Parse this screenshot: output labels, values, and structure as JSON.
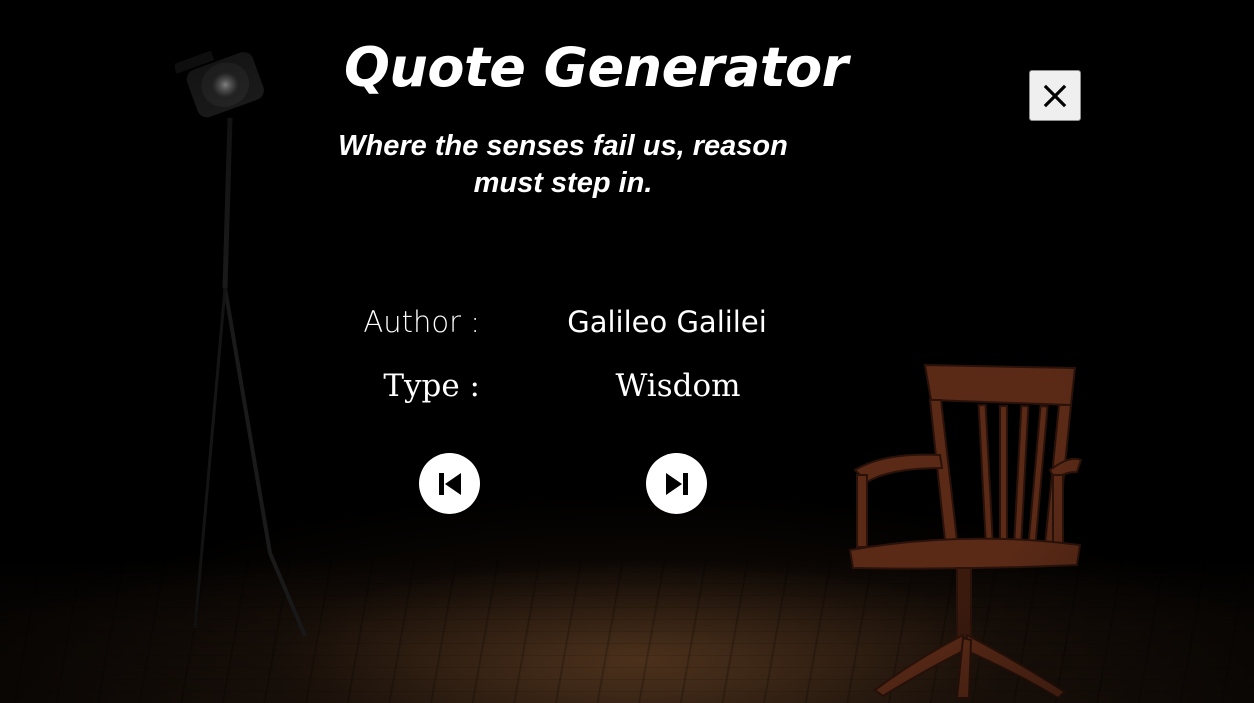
{
  "app": {
    "title": "Quote Generator"
  },
  "quote": {
    "text": "Where the senses fail us, reason must step in."
  },
  "details": {
    "author_label": "Author :",
    "author_value": "Galileo Galilei",
    "type_label": "Type :",
    "type_value": "Wisdom"
  },
  "controls": {
    "previous_icon": "skip-previous-icon",
    "next_icon": "skip-next-icon",
    "close_icon": "close-icon"
  },
  "background": {
    "scene": "dark stage with spotlight and wooden chair on plank floor",
    "floor_color": "#5a3a22",
    "chair_color": "#5b2a17"
  }
}
